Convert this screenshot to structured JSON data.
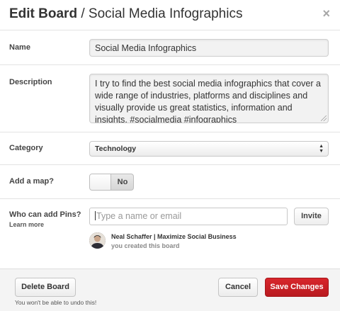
{
  "dialog": {
    "title_bold": "Edit Board",
    "title_rest": " / Social Media Infographics",
    "close_icon": "×"
  },
  "fields": {
    "name": {
      "label": "Name",
      "value": "Social Media Infographics"
    },
    "description": {
      "label": "Description",
      "value": "I try to find the best social media infographics that cover a wide range of industries, platforms and disciplines and visually provide us great statistics, information and insights. #socialmedia #infographics"
    },
    "category": {
      "label": "Category",
      "selected": "Technology"
    },
    "map": {
      "label": "Add a map?",
      "state": "No"
    },
    "pins": {
      "label": "Who can add Pins?",
      "learn_more": "Learn more",
      "placeholder": "Type a name or email",
      "invite_label": "Invite"
    }
  },
  "collaborators": [
    {
      "name": "Neal Schaffer | Maximize Social Business",
      "note": "you created this board"
    }
  ],
  "footer": {
    "delete_label": "Delete Board",
    "undo_note": "You won't be able to undo this!",
    "cancel_label": "Cancel",
    "save_label": "Save Changes"
  },
  "colors": {
    "save_button": "#c9202a",
    "footer_bg": "#f4f4f4"
  }
}
